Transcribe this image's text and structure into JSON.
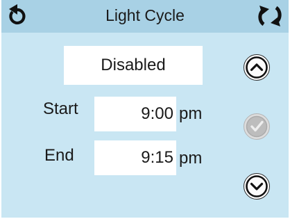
{
  "header": {
    "title": "Light Cycle",
    "back_icon": "back-arrow-icon",
    "cycle_icon": "cycle-arrows-icon"
  },
  "status": {
    "value": "Disabled"
  },
  "start": {
    "label": "Start",
    "time": "9:00",
    "unit": "pm"
  },
  "end": {
    "label": "End",
    "time": "9:15",
    "unit": "pm"
  },
  "controls": {
    "up_icon": "chevron-up-icon",
    "ok_icon": "checkmark-icon",
    "down_icon": "chevron-down-icon"
  },
  "colors": {
    "background": "#c9e6f3",
    "header": "#a8d1e5",
    "box": "#ffffff",
    "text": "#1a1a1a"
  }
}
